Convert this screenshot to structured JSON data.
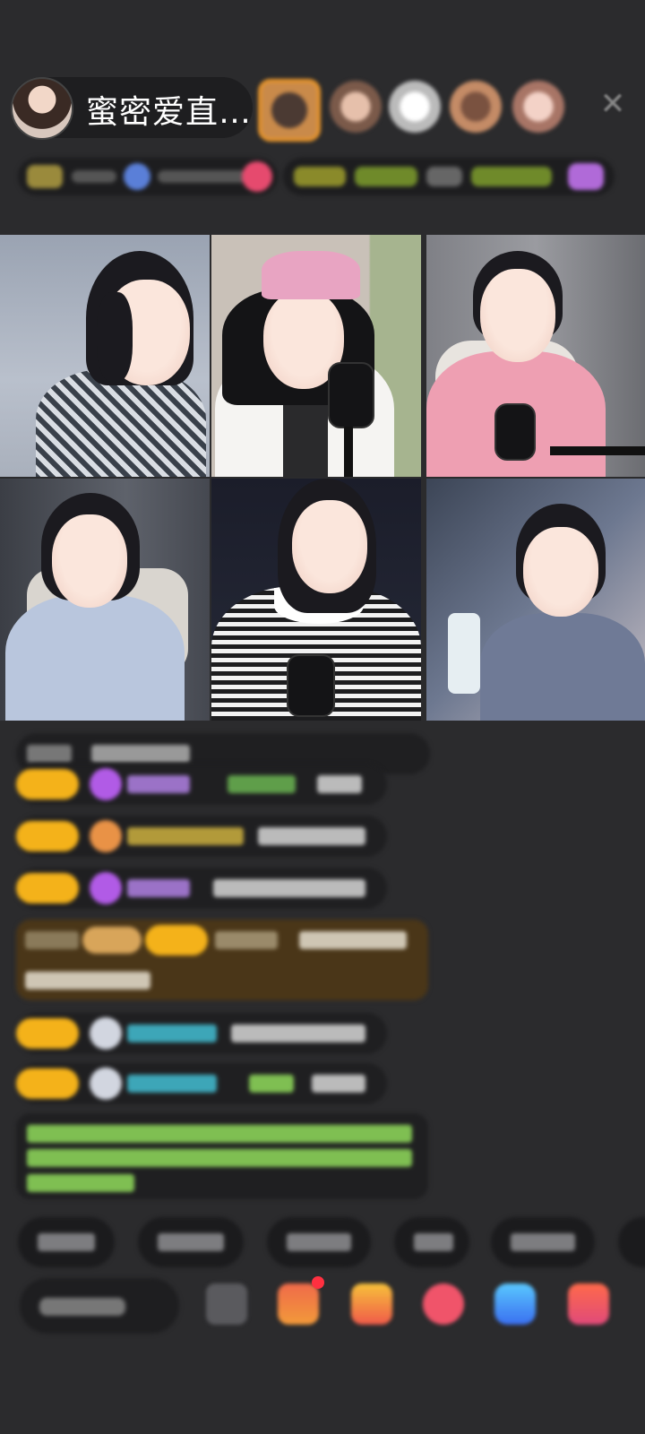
{
  "header": {
    "host_name": "蜜密爱直…",
    "close_icon": "close-icon"
  },
  "viewers": [
    {
      "color": "#b9753e"
    },
    {
      "color": "#c59a86"
    },
    {
      "color": "#e5e1de"
    },
    {
      "color": "#b77c54"
    },
    {
      "color": "#e9c0b6"
    }
  ],
  "colors": {
    "background": "#2b2b2d",
    "gift_badge": "#f4b21a",
    "highlight_message_bg": "#4a3618",
    "system_text": "#7fbf52",
    "name_purple": "#a66be0",
    "name_teal": "#3da6b8"
  },
  "video_tiles": [
    {
      "id": "guest-1"
    },
    {
      "id": "guest-2"
    },
    {
      "id": "guest-3"
    },
    {
      "id": "guest-4"
    },
    {
      "id": "guest-5"
    },
    {
      "id": "guest-6"
    }
  ],
  "bottom_bar": {
    "icons": [
      "emoji-icon",
      "gift-box-icon",
      "gift-bag-icon",
      "red-envelope-icon",
      "share-icon",
      "more-gift-icon"
    ]
  }
}
